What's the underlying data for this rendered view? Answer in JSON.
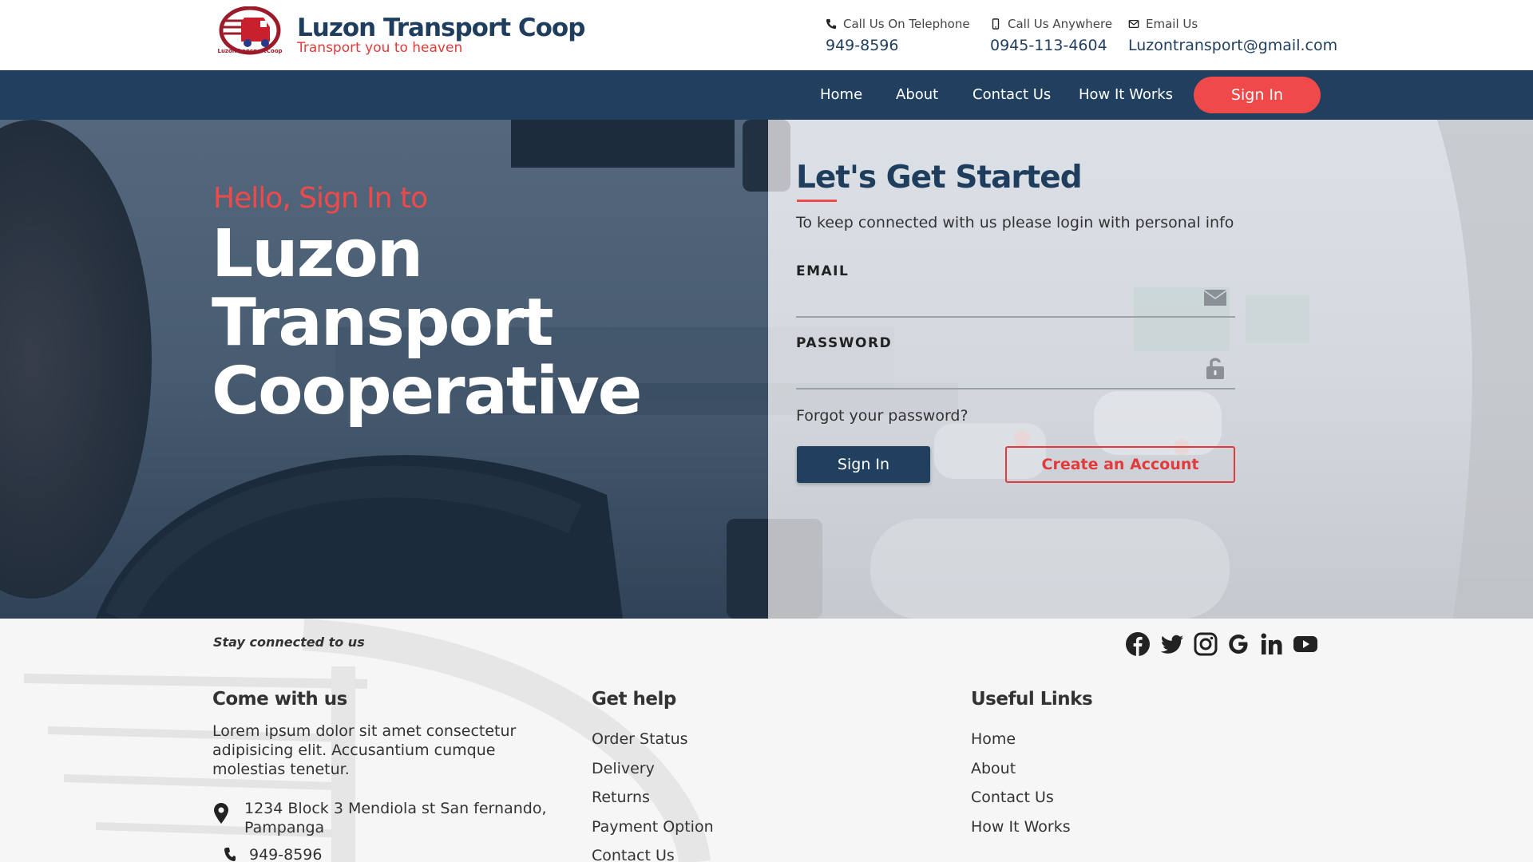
{
  "brand": {
    "name": "Luzon Transport Coop",
    "tagline": "Transport you to heaven",
    "logo_text": "LuzonTransportCoop"
  },
  "contacts": [
    {
      "label": "Call Us On Telephone",
      "value": "949-8596",
      "icon": "phone-icon"
    },
    {
      "label": "Call Us Anywhere",
      "value": "0945-113-4604",
      "icon": "mobile-icon"
    },
    {
      "label": "Email Us",
      "value": "Luzontransport@gmail.com",
      "icon": "envelope-icon"
    }
  ],
  "nav": {
    "items": [
      "Home",
      "About",
      "Contact Us",
      "How It Works"
    ],
    "signin_label": "Sign In"
  },
  "hero": {
    "hello": "Hello, Sign In to",
    "line1": "Luzon",
    "line2": "Transport",
    "line3": "Cooperative"
  },
  "form": {
    "title": "Let's Get Started",
    "subtitle": "To keep connected with us please login with personal info",
    "email_label": "EMAIL",
    "email_value": "",
    "password_label": "PASSWORD",
    "password_value": "",
    "forgot": "Forgot your password?",
    "signin_button": "Sign In",
    "create_button": "Create an Account"
  },
  "footer": {
    "stay_connected": "Stay connected to us",
    "social_icons": [
      "facebook-icon",
      "twitter-icon",
      "instagram-icon",
      "google-icon",
      "linkedin-icon",
      "youtube-icon"
    ],
    "come_with_us": {
      "title": "Come with us",
      "text": "Lorem ipsum dolor sit amet consectetur adipisicing elit. Accusantium cumque molestias tenetur.",
      "address": "1234 Block 3 Mendiola st San fernando, Pampanga",
      "phone": "949-8596"
    },
    "get_help": {
      "title": "Get help",
      "links": [
        "Order Status",
        "Delivery",
        "Returns",
        "Payment Option",
        "Contact Us"
      ]
    },
    "useful_links": {
      "title": "Useful Links",
      "links": [
        "Home",
        "About",
        "Contact Us",
        "How It Works"
      ]
    }
  },
  "colors": {
    "navy": "#21405f",
    "accent_red": "#f0494a",
    "brand_red": "#e23b3b"
  }
}
